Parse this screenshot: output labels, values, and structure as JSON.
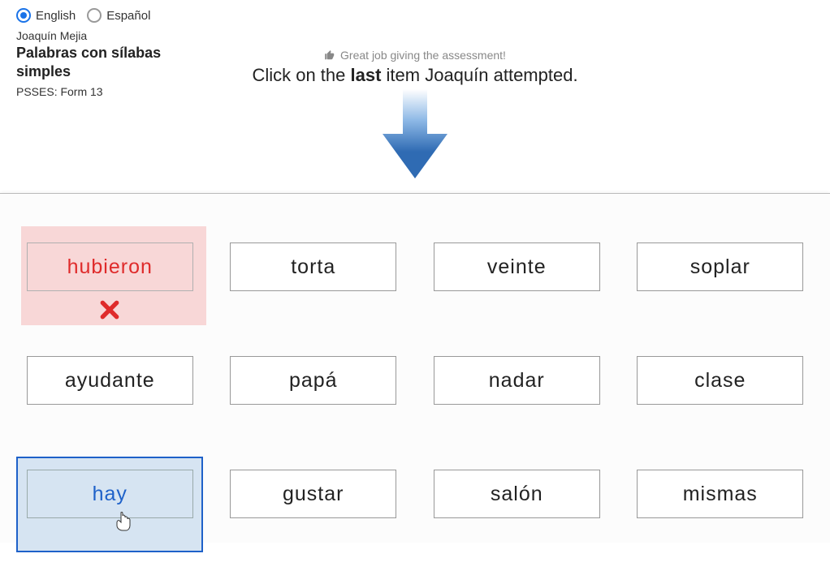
{
  "lang": {
    "english": "English",
    "espanol": "Español"
  },
  "student": "Joaquín Mejia",
  "title": "Palabras con sílabas simples",
  "form": "PSSES: Form 13",
  "praise": "Great job giving the assessment!",
  "instr_pre": "Click on the ",
  "instr_bold": "last",
  "instr_post": " item Joaquín attempted.",
  "words": {
    "r1c1": "hubieron",
    "r1c2": "torta",
    "r1c3": "veinte",
    "r1c4": "soplar",
    "r2c1": "ayudante",
    "r2c2": "papá",
    "r2c3": "nadar",
    "r2c4": "clase",
    "r3c1": "hay",
    "r3c2": "gustar",
    "r3c3": "salón",
    "r3c4": "mismas"
  }
}
